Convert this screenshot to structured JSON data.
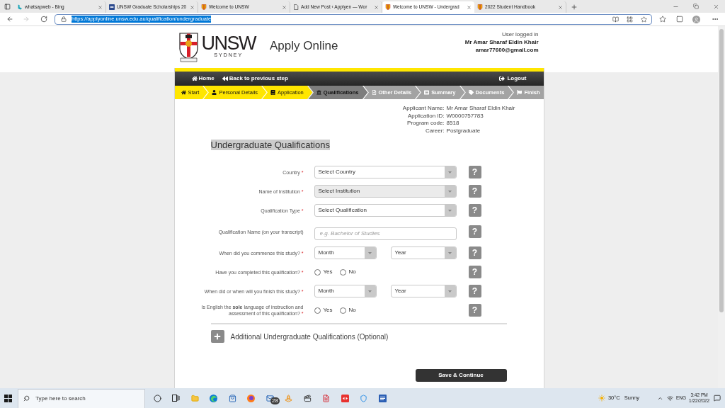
{
  "browser": {
    "tabs": [
      {
        "title": "whatsapweb - Bing",
        "selected": false
      },
      {
        "title": "UNSW Graduate Scholarships 20",
        "selected": false
      },
      {
        "title": "Welcome to UNSW",
        "selected": false
      },
      {
        "title": "Add New Post ‹ Applyen — Wor",
        "selected": false
      },
      {
        "title": "Welcome to UNSW - Undergrad",
        "selected": true
      },
      {
        "title": "2022 Student Handbook",
        "selected": false
      }
    ],
    "address": {
      "url": "https://applyonline.unsw.edu.au/qualification/undergraduate",
      "selected": true
    }
  },
  "header": {
    "logo": {
      "wordmark": "UNSW",
      "city": "SYDNEY"
    },
    "title": "Apply Online",
    "user": {
      "caption": "User logged in",
      "name": "Mr Amar Sharaf Eldin Khair",
      "email": "amar77600@gmail.com"
    }
  },
  "nav": {
    "links": [
      {
        "label": "Home"
      },
      {
        "label": "Back to previous step"
      }
    ],
    "logout": "Logout"
  },
  "steps": [
    {
      "label": "Start",
      "completed": true,
      "selected": false
    },
    {
      "label": "Personal Details",
      "completed": true,
      "selected": false
    },
    {
      "label": "Application",
      "completed": true,
      "selected": false
    },
    {
      "label": "Qualifications",
      "completed": false,
      "selected": true
    },
    {
      "label": "Other Details",
      "completed": false,
      "selected": false
    },
    {
      "label": "Summary",
      "completed": false,
      "selected": false
    },
    {
      "label": "Documents",
      "completed": false,
      "selected": false
    },
    {
      "label": "Finish",
      "completed": false,
      "selected": false
    }
  ],
  "applicant": [
    {
      "label": "Applicant Name:",
      "value": "Mr Amar Sharaf Eldin Khair"
    },
    {
      "label": "Application ID:",
      "value": "W0000757783"
    },
    {
      "label": "Program code:",
      "value": "8518"
    },
    {
      "label": "Career:",
      "value": "Postgraduate"
    }
  ],
  "form": {
    "title": "Undergraduate Qualifications",
    "title_highlighted": true,
    "fields": [
      {
        "kind": "select",
        "label": "Country",
        "required_mark": "*",
        "value": "Select Country",
        "disabled": false,
        "help": "?"
      },
      {
        "kind": "select",
        "label": "Name of Institution",
        "required_mark": "*",
        "value": "Select Institution",
        "disabled": true,
        "help": "?"
      },
      {
        "kind": "select",
        "label": "Qualification Type",
        "required_mark": "*",
        "value": "Select Qualification",
        "disabled": false,
        "help": "?"
      },
      {
        "kind": "text",
        "label": "Qualification Name (on your transcript)",
        "placeholder": "e.g. Bachelor of Studies",
        "help": "?"
      },
      {
        "kind": "date",
        "label": "When did you commence this study?",
        "required_mark": "*",
        "month": "Month",
        "year": "Year",
        "help": "?"
      },
      {
        "kind": "radio",
        "label": "Have you completed this qualification?",
        "required_mark": "*",
        "options": [
          {
            "label": "Yes",
            "selected": false
          },
          {
            "label": "No",
            "selected": false
          }
        ],
        "help": "?"
      },
      {
        "kind": "date",
        "label": "When did or when will you finish this study?",
        "required_mark": "*",
        "month": "Month",
        "year": "Year",
        "help": "?"
      },
      {
        "kind": "radio",
        "label": "Is English the **sole** language of instruction and assessment of this qualification?",
        "required_mark": "*",
        "options": [
          {
            "label": "Yes",
            "selected": false
          },
          {
            "label": "No",
            "selected": false
          }
        ],
        "help": "?"
      }
    ],
    "additional": {
      "label": "Additional Undergraduate Qualifications (Optional)",
      "expanded": false
    },
    "submit": "Save & Continue"
  },
  "taskbar": {
    "search": {
      "placeholder": "Type here to search"
    },
    "mail_badge": "28",
    "weather": {
      "temperature": "30°C",
      "condition": "Sunny"
    },
    "language": "ENG",
    "time": "3:42 PM",
    "date": "1/22/2022"
  }
}
